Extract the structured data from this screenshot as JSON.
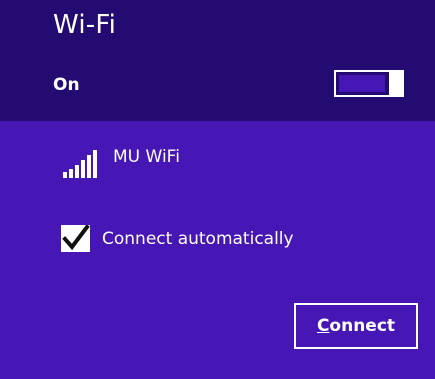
{
  "header": {
    "title": "Wi-Fi",
    "toggle_label": "On",
    "toggle_state": "on"
  },
  "network": {
    "name": "MU WiFi",
    "signal_icon": "wifi-signal-bars-icon",
    "signal_level": 1.0
  },
  "auto_connect": {
    "label": "Connect automatically",
    "checked": true
  },
  "connect_button": {
    "accesskey_letter": "C",
    "label_rest": "onnect"
  },
  "colors": {
    "header_bg": "#240b72",
    "panel_bg": "#4617b4",
    "foreground": "#ffffff"
  }
}
